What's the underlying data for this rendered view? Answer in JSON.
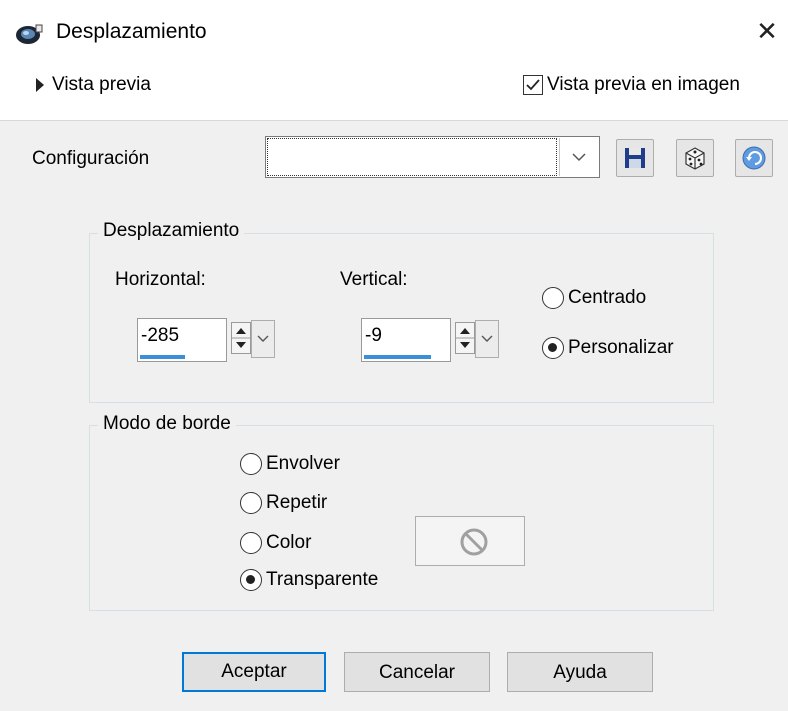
{
  "window": {
    "title": "Desplazamiento",
    "close_glyph": "✕"
  },
  "preview": {
    "toggle_label": "Vista previa",
    "image_preview_label": "Vista previa en imagen",
    "image_preview_checked": true
  },
  "config": {
    "label": "Configuración",
    "value": ""
  },
  "displacement": {
    "legend": "Desplazamiento",
    "horizontal_label": "Horizontal:",
    "horizontal_value": "-285",
    "vertical_label": "Vertical:",
    "vertical_value": "-9",
    "centered_label": "Centrado",
    "custom_label": "Personalizar",
    "selected": "custom"
  },
  "border_mode": {
    "legend": "Modo de borde",
    "options": [
      "Envolver",
      "Repetir",
      "Color",
      "Transparente"
    ],
    "selected": "Transparente"
  },
  "buttons": {
    "ok": "Aceptar",
    "cancel": "Cancelar",
    "help": "Ayuda"
  },
  "icons": {
    "app": "displacement-app-icon",
    "save": "floppy-save-icon",
    "random": "dice-icon",
    "reset": "reset-arrow-icon",
    "none": "no-symbol-icon"
  },
  "colors": {
    "accent": "#0078d7",
    "progress": "#3c8ed8"
  }
}
